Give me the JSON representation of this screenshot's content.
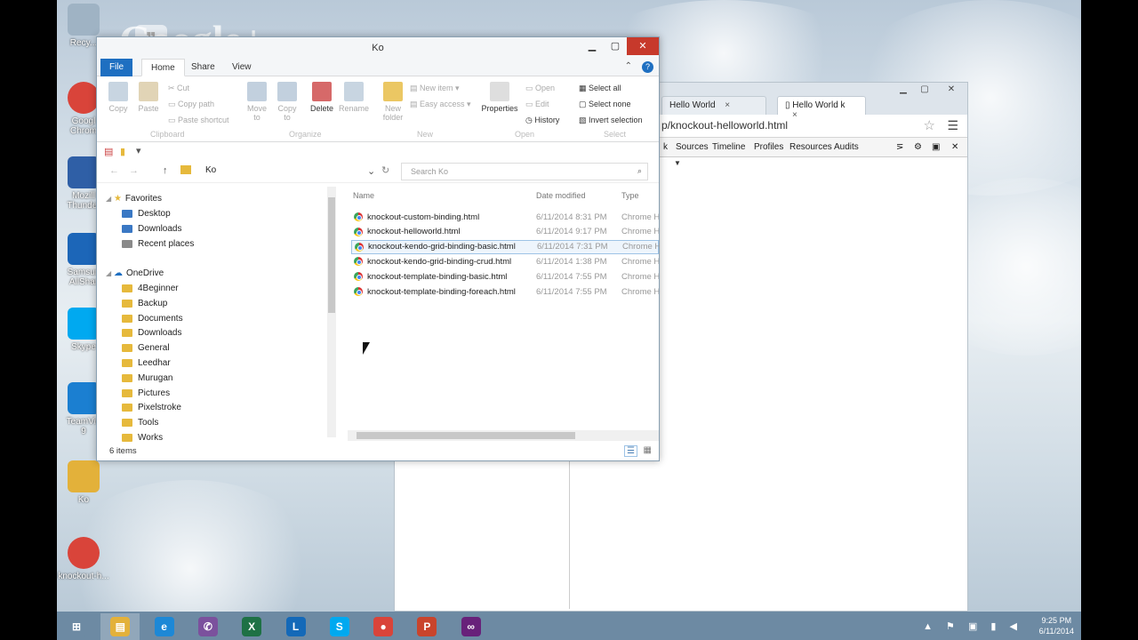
{
  "desktop": {
    "icons": [
      {
        "label": "Recy...",
        "color": "#9fb3c4"
      },
      {
        "label": "Googl\nChrom",
        "color": "#d9443a"
      },
      {
        "label": "Mozill\nThunder",
        "color": "#2f5fa6"
      },
      {
        "label": "Samsun\nAllShar",
        "color": "#1c66b8"
      },
      {
        "label": "Skype",
        "color": "#00a9f0"
      },
      {
        "label": "TeamVie\n9",
        "color": "#1b7fd1"
      },
      {
        "label": "Ko",
        "color": "#e3b13a"
      },
      {
        "label": "knockout-h...",
        "color": "#d9443a"
      }
    ],
    "gplus": "Google+"
  },
  "chrome": {
    "tabs": [
      {
        "label": "Hello World",
        "close": "×"
      },
      {
        "label": "Hello World k",
        "close": "×"
      }
    ],
    "address": "p/knockout-helloworld.html",
    "devtools_tabs": [
      "k",
      "Sources",
      "Timeline",
      "Profiles",
      "Resources",
      "Audits"
    ],
    "devtools_caret": "▼"
  },
  "explorer": {
    "title": "Ko",
    "ribbon_tabs": [
      "File",
      "Home",
      "Share",
      "View"
    ],
    "ribbon": {
      "copy": "Copy",
      "paste": "Paste",
      "cut": "Cut",
      "copy_path": "Copy path",
      "paste_shortcut": "Paste shortcut",
      "move_to": "Move\nto",
      "copy_to": "Copy\nto",
      "delete": "Delete",
      "rename": "Rename",
      "new_folder": "New\nfolder",
      "new_item": "New item",
      "easy_access": "Easy access",
      "properties": "Properties",
      "open": "Open",
      "edit": "Edit",
      "history": "History",
      "select_all": "Select all",
      "select_none": "Select none",
      "invert_selection": "Invert selection",
      "groups": [
        "Clipboard",
        "Organize",
        "New",
        "Open",
        "Select"
      ]
    },
    "path": "Ko",
    "search_placeholder": "Search Ko",
    "nav": {
      "favorites": "Favorites",
      "favorites_items": [
        "Desktop",
        "Downloads",
        "Recent places"
      ],
      "onedrive": "OneDrive",
      "onedrive_items": [
        "4Beginner",
        "Backup",
        "Documents",
        "Downloads",
        "General",
        "Leedhar",
        "Murugan",
        "Pictures",
        "Pixelstroke",
        "Tools",
        "Works"
      ]
    },
    "columns": {
      "name": "Name",
      "date": "Date modified",
      "type": "Type"
    },
    "files": [
      {
        "name": "knockout-custom-binding.html",
        "date": "6/11/2014 8:31 PM",
        "type": "Chrome H"
      },
      {
        "name": "knockout-helloworld.html",
        "date": "6/11/2014 9:17 PM",
        "type": "Chrome H"
      },
      {
        "name": "knockout-kendo-grid-binding-basic.html",
        "date": "6/11/2014 7:31 PM",
        "type": "Chrome H"
      },
      {
        "name": "knockout-kendo-grid-binding-crud.html",
        "date": "6/11/2014 1:38 PM",
        "type": "Chrome H"
      },
      {
        "name": "knockout-template-binding-basic.html",
        "date": "6/11/2014 7:55 PM",
        "type": "Chrome H"
      },
      {
        "name": "knockout-template-binding-foreach.html",
        "date": "6/11/2014 7:55 PM",
        "type": "Chrome H"
      }
    ],
    "status": "6 items"
  },
  "taskbar": {
    "items": [
      {
        "name": "start",
        "glyph": "⊞",
        "color": "#6d8aa3"
      },
      {
        "name": "file-explorer",
        "glyph": "▤",
        "color": "#e3b13a"
      },
      {
        "name": "internet-explorer",
        "glyph": "e",
        "color": "#1d88d6"
      },
      {
        "name": "viber",
        "glyph": "✆",
        "color": "#7b519d"
      },
      {
        "name": "excel",
        "glyph": "X",
        "color": "#1e7145"
      },
      {
        "name": "lync",
        "glyph": "L",
        "color": "#1469b8"
      },
      {
        "name": "skype",
        "glyph": "S",
        "color": "#00a9f0"
      },
      {
        "name": "chrome",
        "glyph": "●",
        "color": "#d9443a"
      },
      {
        "name": "powerpoint",
        "glyph": "P",
        "color": "#c9442c"
      },
      {
        "name": "visual-studio",
        "glyph": "∞",
        "color": "#68217a"
      }
    ],
    "tray": "▲ ⚑ ▣ ▮ ◀",
    "time": "9:25 PM",
    "date": "6/11/2014"
  }
}
